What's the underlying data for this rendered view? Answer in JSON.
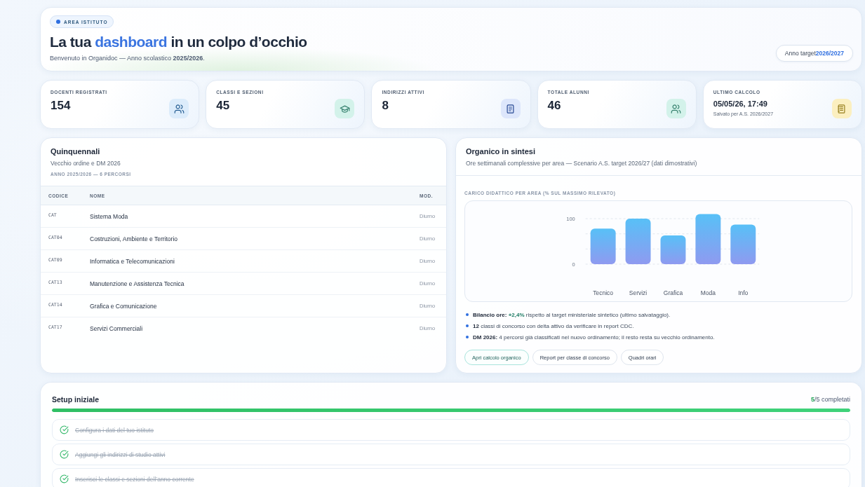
{
  "header": {
    "tag": "AREA ISTITUTO",
    "title": {
      "before": "La tua",
      "highlight": "dashboard",
      "after": "in un colpo d’occhio"
    },
    "subtitle": "Benvenuto in Organidoc — Anno scolastico **2025/2026**.",
    "target_button": {
      "label": "Anno target",
      "value": "2026/2027"
    }
  },
  "stats": [
    {
      "kind": "count",
      "label": "DOCENTI REGISTRATI",
      "value": "154",
      "color": "#dcecfb"
    },
    {
      "kind": "count",
      "label": "CLASSI E SEZIONI",
      "value": "45",
      "color": "#d3f2ea"
    },
    {
      "kind": "count",
      "label": "INDIRIZZI ATTIVI",
      "value": "8",
      "color": "#dde6fb"
    },
    {
      "kind": "count",
      "label": "TOTALE ALUNNI",
      "value": "46",
      "color": "#d3f2ea"
    },
    {
      "kind": "timestamp",
      "label": "ULTIMO CALCOLO",
      "value": "05/05/26, 17:49",
      "note": "Salvato per A.S. 2026/2027",
      "color": "#fbefc0"
    }
  ],
  "courses": {
    "title": "Quinquennali",
    "subtitle": "Vecchio ordine e DM 2026",
    "meta": "ANNO 2025/2026 — 6 PERCORSI",
    "table": {
      "columns": [
        "CODICE",
        "NOME",
        "MOD."
      ],
      "rows": [
        [
          "CAT",
          "Sistema Moda",
          "Diurno"
        ],
        [
          "CAT04",
          "Costruzioni, Ambiente e Territorio",
          "Diurno"
        ],
        [
          "CAT09",
          "Informatica e Telecomunicazioni",
          "Diurno"
        ],
        [
          "CAT13",
          "Manutenzione e Assistenza Tecnica",
          "Diurno"
        ],
        [
          "CAT14",
          "Grafica e Comunicazione",
          "Diurno"
        ],
        [
          "CAT17",
          "Servizi Commerciali",
          "Diurno"
        ]
      ]
    }
  },
  "summary": {
    "title": "Organico in sintesi",
    "subtitle": "Ore settimanali complessive per area — Scenario A.S. target 2026/27 (dati dimostrativi)",
    "chart_data": {
      "type": "bar",
      "title": "CARICO DIDATTICO PER AREA (% SUL MASSIMO RILEVATO)",
      "categories": [
        "Tecnico",
        "Servizi",
        "Grafica",
        "Moda",
        "Info"
      ],
      "values": [
        78,
        100,
        63,
        110,
        87
      ],
      "ylim": [
        0,
        110
      ],
      "yticks": [
        0,
        100
      ]
    },
    "notes": [
      {
        "lead": "Bilancio ore:",
        "highlight": "+2,4%",
        "text": "rispetto al target ministeriale sintetico (ultimo salvataggio)."
      },
      {
        "lead": "12",
        "text": "classi di concorso con delta attivo da verificare in report CDC."
      },
      {
        "lead": "DM 2026:",
        "text": "4 percorsi già classificati nel nuovo ordinamento; il resto resta su vecchio ordinamento."
      }
    ],
    "actions": [
      {
        "label": "Apri calcolo organico",
        "kind": "primary"
      },
      {
        "label": "Report per classe di concorso",
        "kind": "secondary"
      },
      {
        "label": "Quadri orari",
        "kind": "secondary"
      }
    ]
  },
  "setup": {
    "title": "Setup iniziale",
    "progress": {
      "done": "5",
      "rest": "/5 completati",
      "level": 1
    },
    "items": [
      {
        "label": "Configura i dati del tuo istituto",
        "done": true
      },
      {
        "label": "Aggiungi gli indirizzi di studio attivi",
        "done": true
      },
      {
        "label": "Inserisci le classi e sezioni dell’anno corrente",
        "done": true
      }
    ]
  }
}
